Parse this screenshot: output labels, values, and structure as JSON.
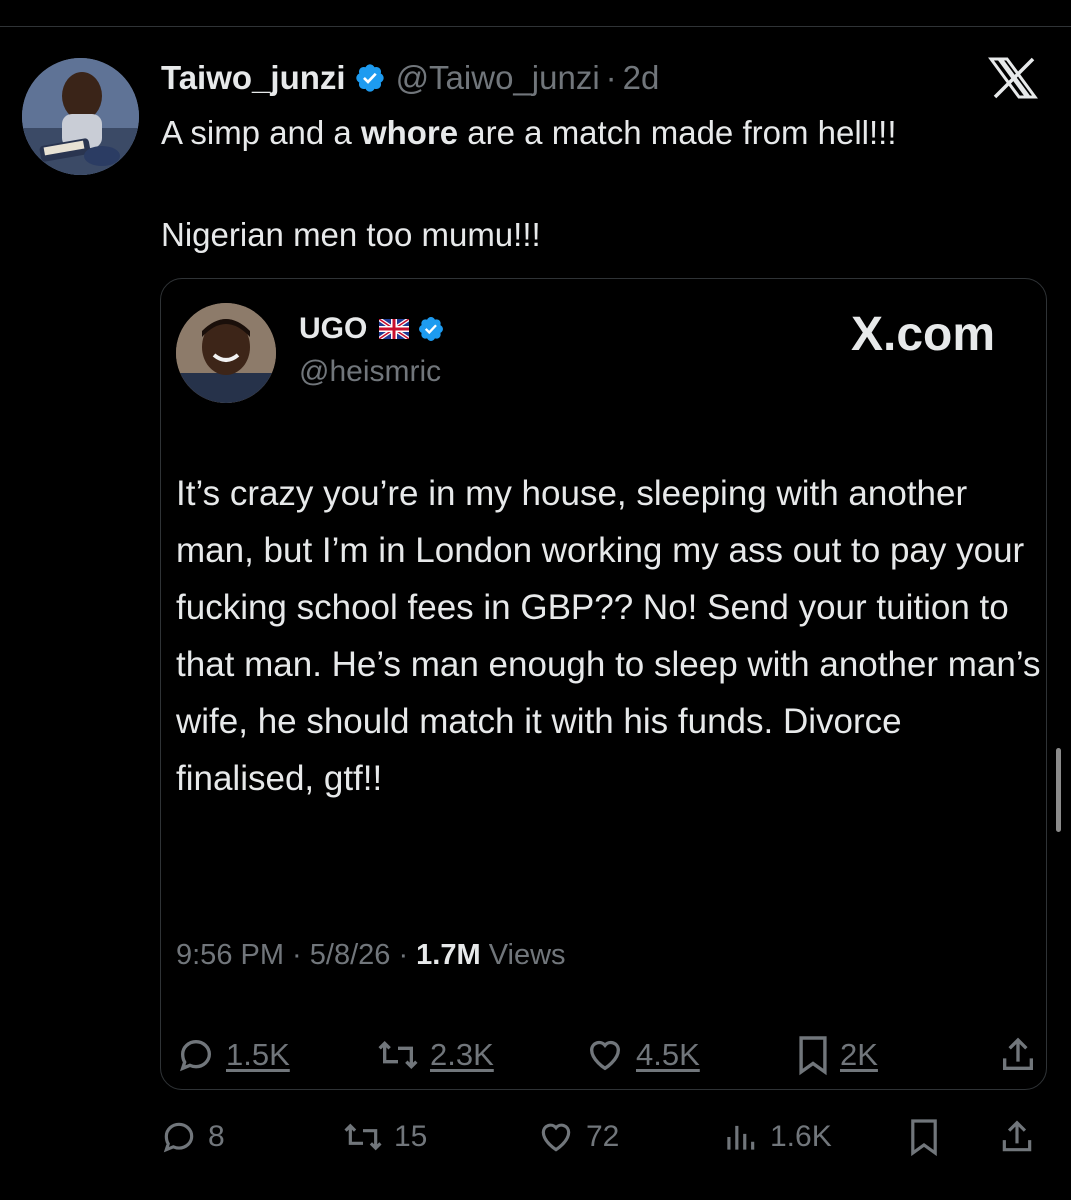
{
  "tweet": {
    "display_name": "Taiwo_junzi",
    "handle": "@Taiwo_junzi",
    "separator": "·",
    "time": "2d",
    "text_before_bold": "A simp and a ",
    "text_bold": "whore",
    "text_after_bold": " are a match made from hell!!!",
    "text_line2": "Nigerian men too mumu!!!",
    "icons": {
      "verified": "verified-badge-icon",
      "logo": "x-logo-icon"
    },
    "colors": {
      "background": "#000000",
      "text": "#e7e9ea",
      "muted": "#71767b",
      "verified": "#1d9bf0",
      "border": "#2f3336"
    }
  },
  "quote": {
    "display_name": "UGO",
    "handle": "@heismric",
    "brand": "X.com",
    "text": "It’s crazy you’re in my house, sleeping with another man, but I’m in London working my ass out to pay your fucking school fees in GBP?? No! Send your tuition to that man. He’s man enough to sleep with another man’s wife, he should match it with his funds. Divorce finalised, gtf!!",
    "meta_time": "9:56 PM · 5/8/26 · ",
    "meta_views_count": "1.7M",
    "meta_views_label": " Views",
    "actions": {
      "replies": "1.5K",
      "reposts": "2.3K",
      "likes": "4.5K",
      "bookmarks": "2K"
    },
    "icons": [
      "uk-flag-icon",
      "verified-badge-icon",
      "reply-icon",
      "repost-icon",
      "like-icon",
      "bookmark-icon",
      "share-icon"
    ]
  },
  "actions": {
    "replies": "8",
    "reposts": "15",
    "likes": "72",
    "views": "1.6K"
  }
}
